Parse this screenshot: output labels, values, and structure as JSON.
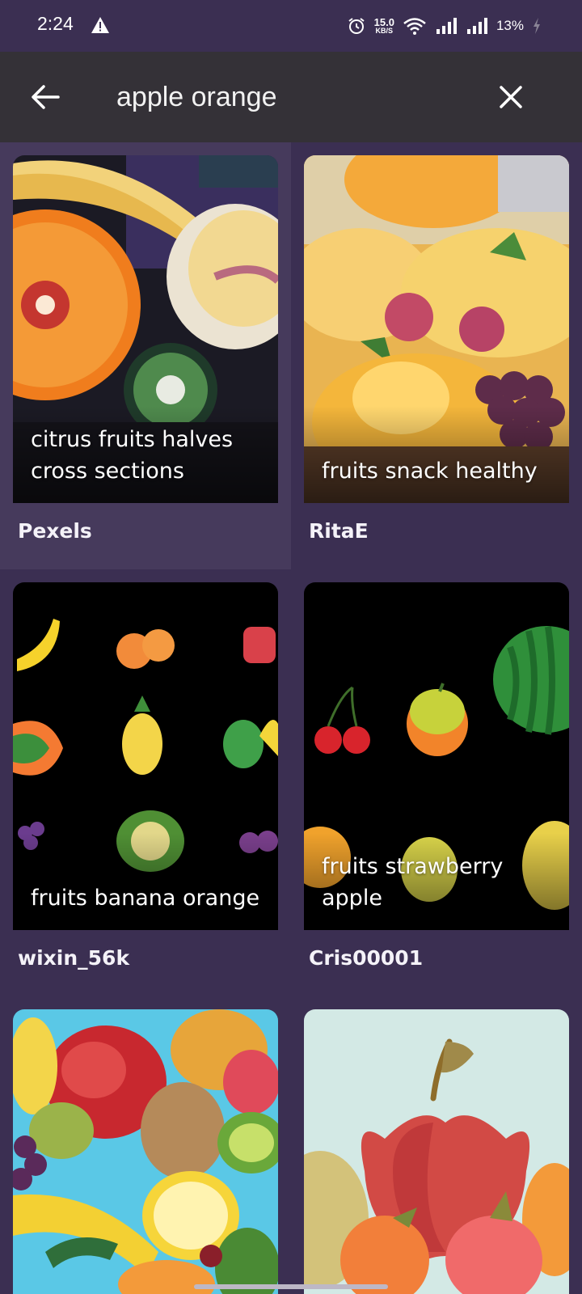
{
  "status_bar": {
    "time": "2:24",
    "net_speed_value": "15.0",
    "net_speed_unit": "KB/S",
    "battery": "13%",
    "icons": [
      "warning-icon",
      "alarm-icon",
      "wifi-icon",
      "signal-icon",
      "signal-icon",
      "charging-icon"
    ]
  },
  "search": {
    "query": "apple orange",
    "back_icon": "arrow-left-icon",
    "clear_icon": "close-icon"
  },
  "results": [
    {
      "caption": "citrus fruits  halves cross sections",
      "author": "Pexels"
    },
    {
      "caption": "fruits  snack healthy",
      "author": "RitaE"
    },
    {
      "caption": "fruits  banana orange",
      "author": "wixin_56k"
    },
    {
      "caption": "fruits  strawberry apple",
      "author": "Cris00001"
    },
    {
      "caption": "",
      "author": ""
    },
    {
      "caption": "",
      "author": ""
    }
  ],
  "colors": {
    "background": "#3b2f52",
    "search_bar": "#343137",
    "selected_card": "#463a5c"
  }
}
